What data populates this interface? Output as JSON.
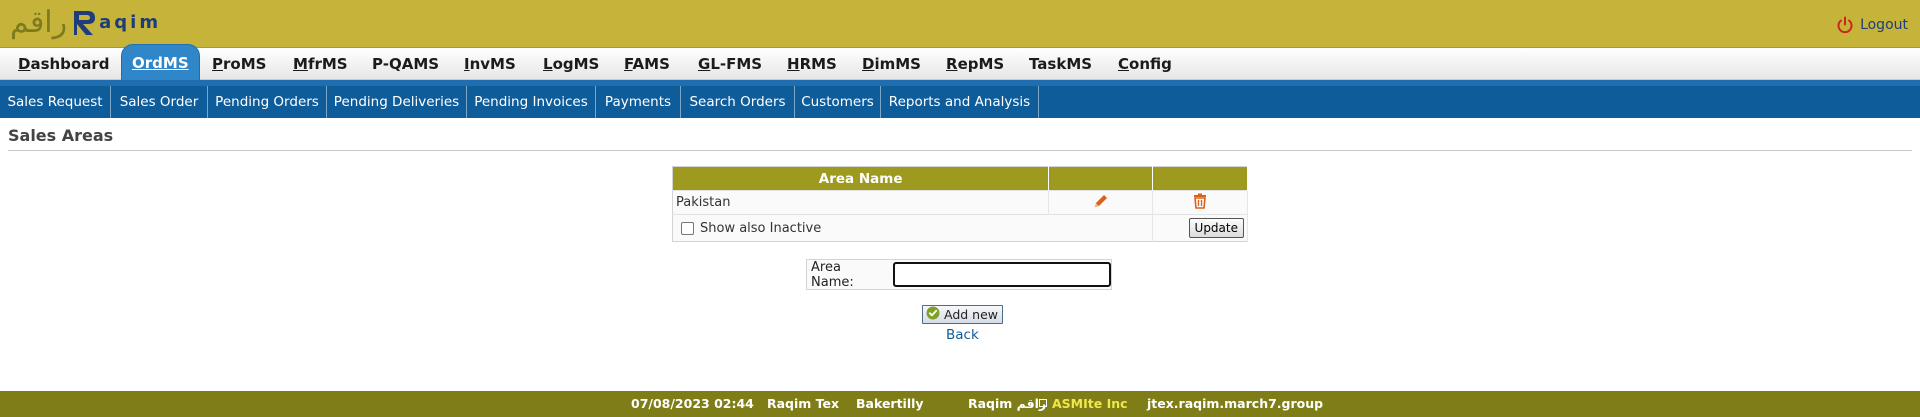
{
  "header": {
    "logo_arabic": "راقم",
    "logo_latin": "aqim",
    "logout_label": "Logout"
  },
  "main_nav": [
    {
      "acc": "D",
      "rest": "ashboard"
    },
    {
      "acc": "",
      "rest": "OrdMS",
      "active": true
    },
    {
      "acc": "P",
      "rest": "roMS"
    },
    {
      "acc": "M",
      "rest": "frMS"
    },
    {
      "acc": "",
      "rest": "P-QAMS"
    },
    {
      "acc": "I",
      "rest": "nvMS"
    },
    {
      "acc": "L",
      "rest": "ogMS"
    },
    {
      "acc": "F",
      "rest": "AMS"
    },
    {
      "acc": "G",
      "rest": "L-FMS"
    },
    {
      "acc": "H",
      "rest": "RMS"
    },
    {
      "acc": "D",
      "rest": "imMS"
    },
    {
      "acc": "R",
      "rest": "epMS"
    },
    {
      "acc": "",
      "rest": "TaskMS"
    },
    {
      "acc": "C",
      "rest": "onfig"
    }
  ],
  "sub_nav": [
    "Sales Request",
    "Sales Order",
    "Pending Orders",
    "Pending Deliveries",
    "Pending Invoices",
    "Payments",
    "Search Orders",
    "Customers",
    "Reports and Analysis"
  ],
  "page": {
    "title": "Sales Areas"
  },
  "table": {
    "header_area_name": "Area Name",
    "rows": [
      {
        "name": "Pakistan"
      }
    ],
    "show_inactive_label": "Show also Inactive",
    "update_label": "Update"
  },
  "form": {
    "area_name_label": "Area Name:",
    "area_name_value": "",
    "add_new_label": "Add new",
    "back_label": "Back"
  },
  "status_bar": {
    "datetime": "07/08/2023 02:44",
    "product": "Raqim Tex",
    "client": "Bakertilly",
    "brand": "Raqim راقم",
    "company": "ASMIte Inc",
    "host": "jtex.raqim.march7.group"
  },
  "colors": {
    "header_bg": "#c6b43a",
    "nav_active": "#2f86c8",
    "subnav_bg": "#0f5c9a",
    "table_header": "#9e9a1f",
    "status_bg": "#7f7d17",
    "icon_orange": "#d9621b"
  }
}
